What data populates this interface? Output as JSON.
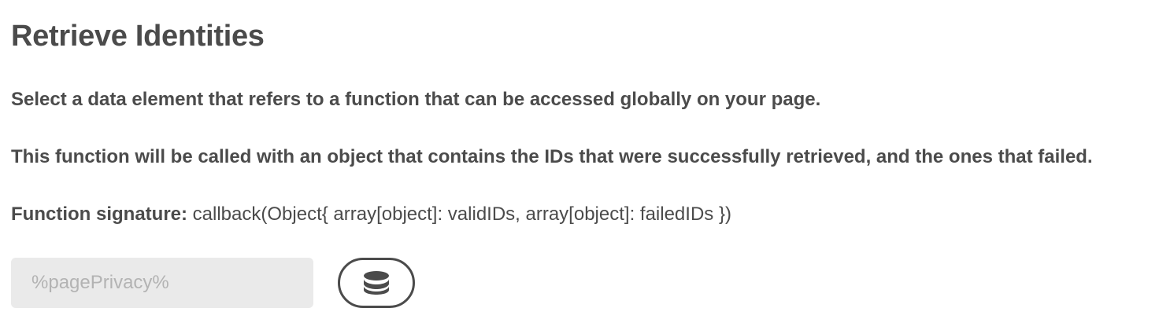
{
  "section": {
    "title": "Retrieve Identities",
    "paragraph_1": "Select a data element that refers to a function that can be accessed globally on your page.",
    "paragraph_2": "This function will be called with an object that contains the IDs that were successfully retrieved, and the ones that failed.",
    "signature_label": "Function signature:",
    "signature_code": " callback(Object{ array[object]: validIDs, array[object]: failedIDs })"
  },
  "data_element_field": {
    "value": "",
    "placeholder": "%pagePrivacy%"
  },
  "data_element_button": {
    "icon": "database-icon"
  },
  "colors": {
    "text": "#4b4b4b",
    "field_bg": "#eaeaea",
    "placeholder": "#b3b3b3"
  }
}
